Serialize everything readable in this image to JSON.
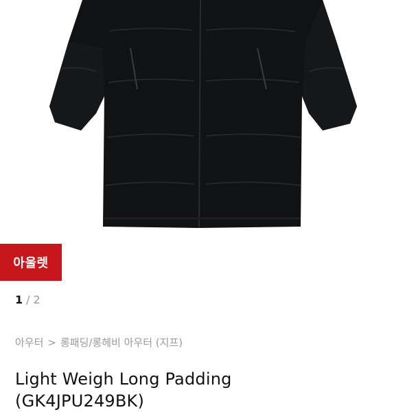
{
  "badge": {
    "label": "아울렛",
    "color": "#c8161d"
  },
  "pager": {
    "current": "1",
    "separator": "/",
    "total": "2"
  },
  "breadcrumb": {
    "category": "아우터",
    "separator": ">",
    "subcategory": "롱패딩/롱헤비 아우터 (지프)"
  },
  "product": {
    "title_line1": "Light Weigh Long Padding",
    "title_line2": "(GK4JPU249BK)",
    "image_icon": "long-padding-coat-image"
  }
}
